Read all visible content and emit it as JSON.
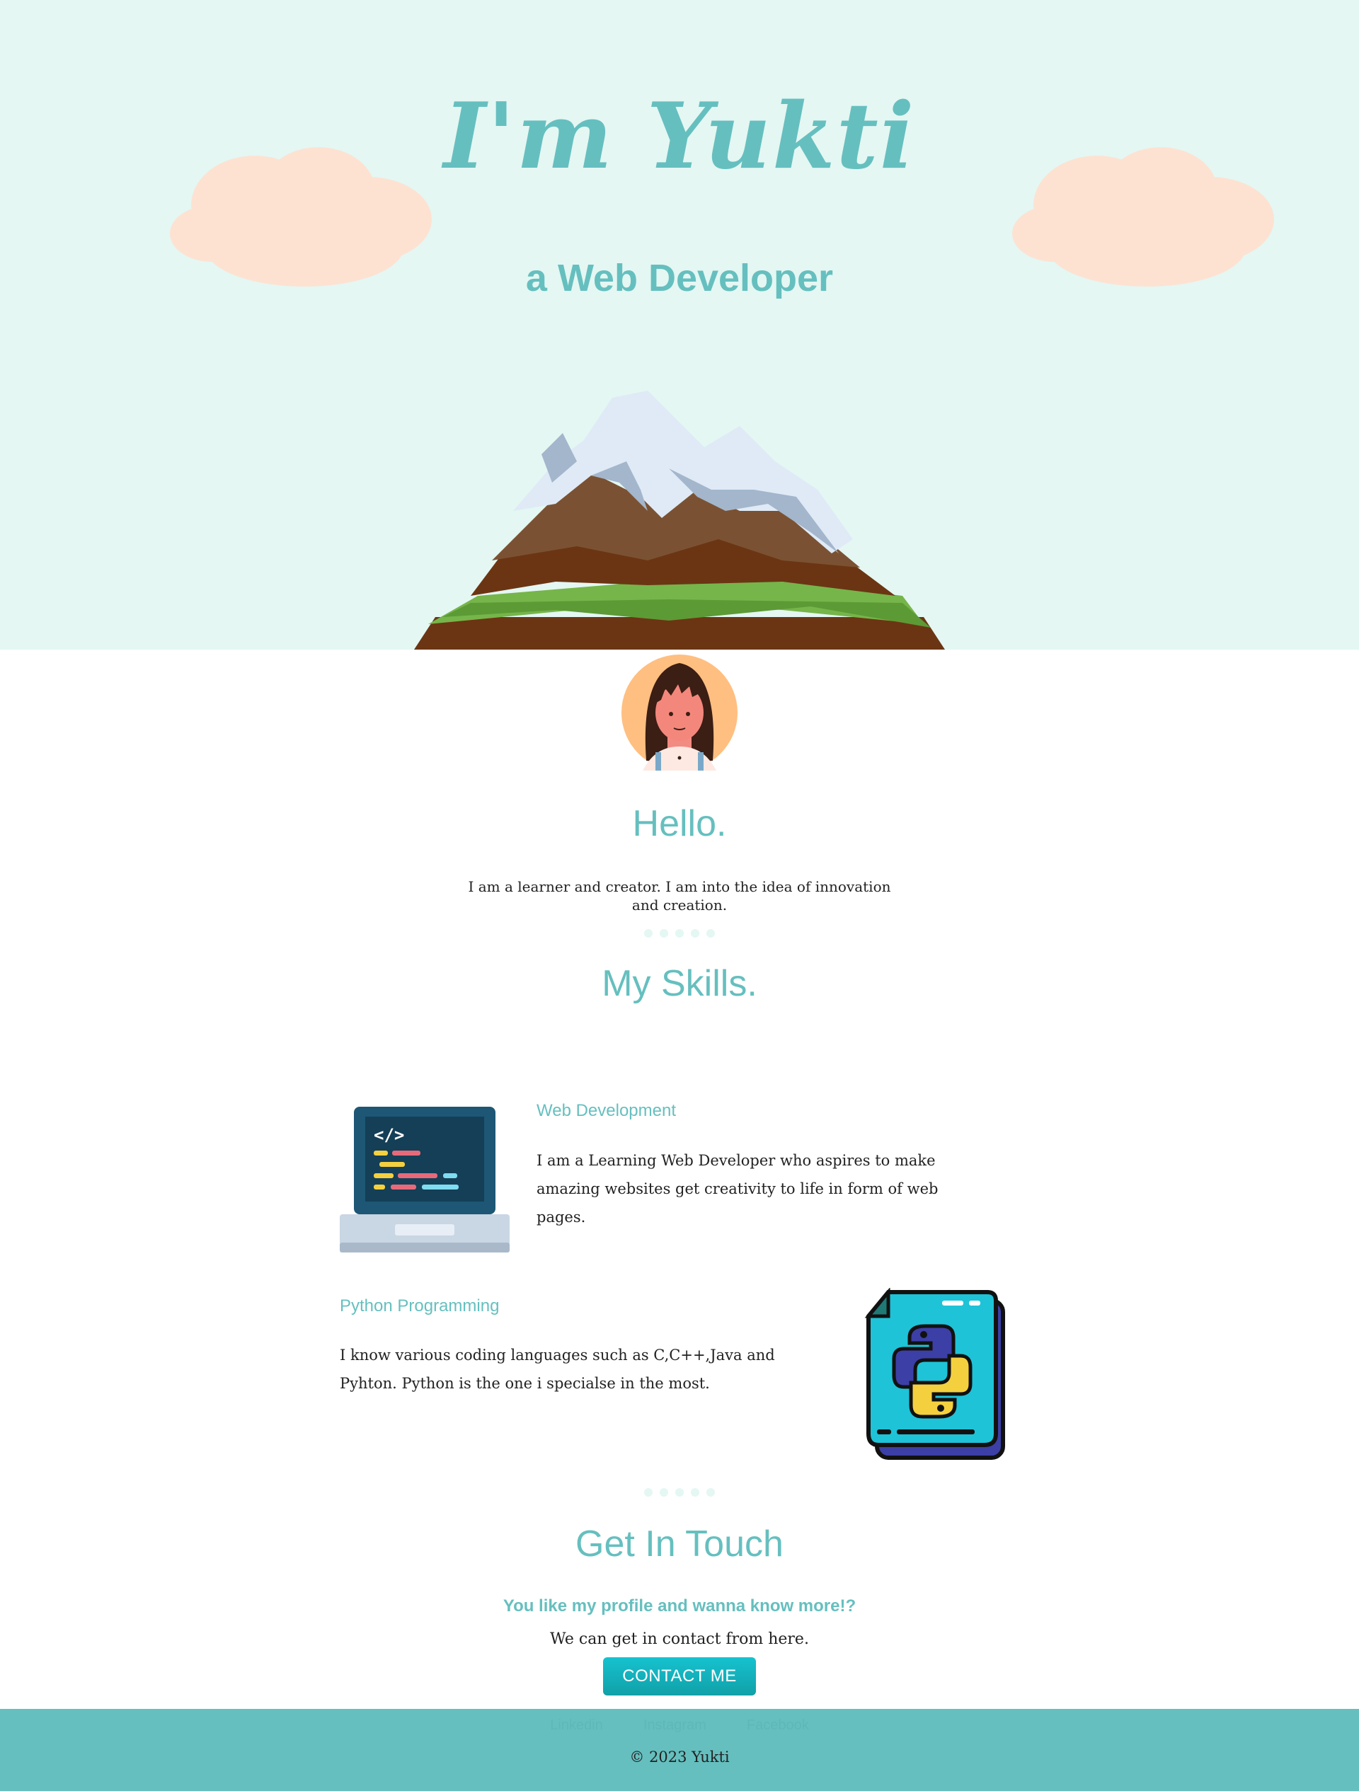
{
  "hero": {
    "title": "I'm Yukti",
    "subtitle": "a Web Developer"
  },
  "about": {
    "title": "Hello.",
    "text": "I am a learner and creator. I am into the idea of innovation and creation."
  },
  "skills": {
    "title": "My Skills.",
    "items": [
      {
        "heading": "Web Development",
        "text": "I am a Learning Web Developer who aspires to make amazing websites get creativity to life in form of web pages.",
        "icon": "laptop-code-icon"
      },
      {
        "heading": "Python Programming",
        "text": "I know various coding languages such as C,C++,Java and Pyhton. Python is the one i specialse in the most.",
        "icon": "python-file-icon"
      }
    ]
  },
  "contact": {
    "title": "Get In Touch",
    "subtitle": "You like my profile and wanna know more!?",
    "text": "We can get in contact from here.",
    "button_label": "CONTACT ME"
  },
  "footer": {
    "links": [
      "Linkedin",
      "Instagram",
      "Facebook"
    ],
    "copyright": "© 2023 Yukti"
  },
  "colors": {
    "accent": "#66bfbf",
    "hero_bg": "#e4f7f3",
    "cloud": "#fde2d2",
    "button": "#11a0a8"
  }
}
